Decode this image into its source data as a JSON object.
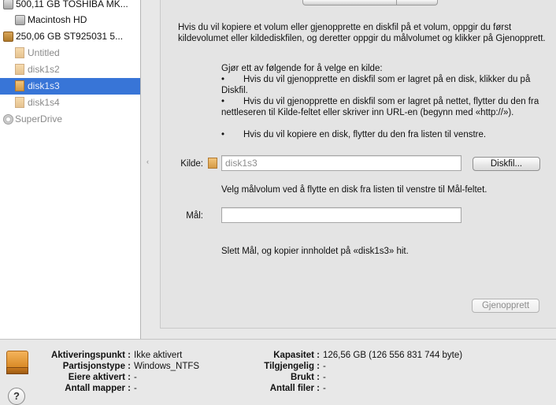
{
  "sidebar": {
    "items": [
      {
        "label": "500,11 GB TOSHIBA MK..."
      },
      {
        "label": "Macintosh HD"
      },
      {
        "label": "250,06 GB ST925031 5..."
      },
      {
        "label": "Untitled"
      },
      {
        "label": "disk1s2"
      },
      {
        "label": "disk1s3"
      },
      {
        "label": "disk1s4"
      },
      {
        "label": "SuperDrive"
      }
    ],
    "selected": "disk1s3"
  },
  "restore": {
    "intro": "Hvis du vil kopiere et volum eller gjenopprette en diskfil på et volum, oppgir du først kildevolumet eller kildediskfilen, og deretter oppgir du målvolumet og klikker på Gjenopprett.",
    "instructions_heading": "Gjør ett av følgende for å velge en kilde:",
    "bullet_char": "•",
    "bullets": [
      "Hvis du vil gjenopprette en diskfil som er lagret på en disk, klikker du på Diskfil.",
      "Hvis du vil gjenopprette en diskfil som er lagret på nettet, flytter du den fra nettleseren til Kilde-feltet eller skriver inn URL-en (begynn med «http://»).",
      "Hvis du vil kopiere en disk, flytter du den fra listen til venstre."
    ],
    "source_label": "Kilde:",
    "source_value": "disk1s3",
    "diskfile_button": "Diskfil...",
    "destination_hint": "Velg målvolum ved å flytte en disk fra listen til venstre til Mål-feltet.",
    "destination_label": "Mål:",
    "destination_value": "",
    "erase_note": "Slett Mål, og kopier innholdet på «disk1s3» hit.",
    "restore_button": "Gjenopprett"
  },
  "info": {
    "left": [
      {
        "key": "Aktiveringspunkt :",
        "value": "Ikke aktivert"
      },
      {
        "key": "Partisjonstype :",
        "value": "Windows_NTFS"
      },
      {
        "key": "Eiere aktivert :",
        "value": "-"
      },
      {
        "key": "Antall mapper :",
        "value": "-"
      }
    ],
    "right": [
      {
        "key": "Kapasitet :",
        "value": "126,56 GB (126 556 831 744 byte)"
      },
      {
        "key": "Tilgjengelig :",
        "value": "-"
      },
      {
        "key": "Brukt :",
        "value": "-"
      },
      {
        "key": "Antall filer :",
        "value": "-"
      }
    ],
    "help": "?"
  },
  "colors": {
    "selection": "#3875d7",
    "partition_icon": "#d49a45"
  }
}
